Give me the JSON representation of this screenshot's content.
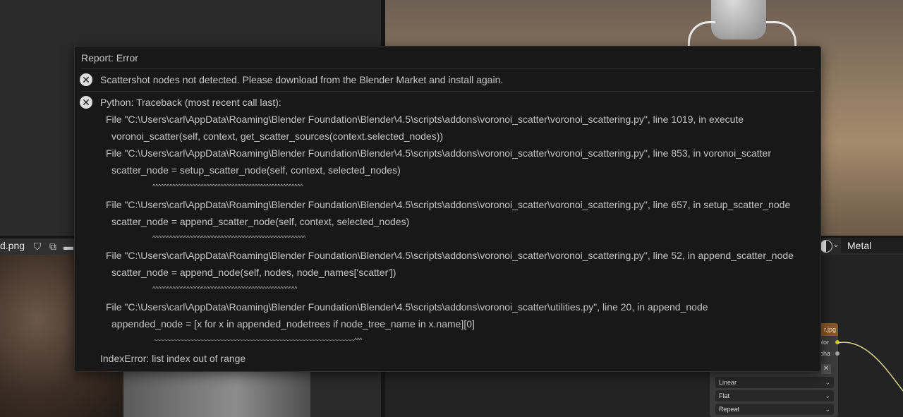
{
  "background": {
    "image_editor": {
      "image_name": "d.png",
      "header_icons": [
        "shield-icon",
        "duplicate-icon",
        "folder-icon"
      ]
    },
    "node_editor": {
      "material_name": "Metal",
      "node": {
        "title": "r.jpg",
        "outputs": [
          "olor",
          "lpha"
        ],
        "dropdowns": [
          "Linear",
          "Flat",
          "Repeat"
        ],
        "close_glyph": "✕"
      }
    },
    "colors": {
      "node_title": "#8a5624",
      "color_socket": "#c8c41e",
      "alpha_socket": "#a0a0a0",
      "wire": "#d8d48a"
    }
  },
  "report": {
    "title": "Report: Error",
    "icon": "error-x-icon",
    "messages": [
      "Scattershot nodes not detected. Please download from the Blender Market and install again.",
      "Python: Traceback (most recent call last):"
    ],
    "traceback": [
      "File \"C:\\Users\\carl\\AppData\\Roaming\\Blender Foundation\\Blender\\4.5\\scripts\\addons\\voronoi_scatter\\voronoi_scattering.py\", line 1019, in execute",
      "voronoi_scatter(self, context, get_scatter_sources(context.selected_nodes))",
      "File \"C:\\Users\\carl\\AppData\\Roaming\\Blender Foundation\\Blender\\4.5\\scripts\\addons\\voronoi_scatter\\voronoi_scattering.py\", line 853, in voronoi_scatter",
      "scatter_node = setup_scatter_node(self, context, selected_nodes)",
      "^^^^^^^^^^^^^^^^^^^^^^^^^^^^^^^^^^^^^^^^^^^^^^^^^^^^^",
      "File \"C:\\Users\\carl\\AppData\\Roaming\\Blender Foundation\\Blender\\4.5\\scripts\\addons\\voronoi_scatter\\voronoi_scattering.py\", line 657, in setup_scatter_node",
      "scatter_node = append_scatter_node(self, context, selected_nodes)",
      "^^^^^^^^^^^^^^^^^^^^^^^^^^^^^^^^^^^^^^^^^^^^^^^^^^^^^^",
      "File \"C:\\Users\\carl\\AppData\\Roaming\\Blender Foundation\\Blender\\4.5\\scripts\\addons\\voronoi_scatter\\voronoi_scattering.py\", line 52, in append_scatter_node",
      "scatter_node = append_node(self, nodes, node_names['scatter'])",
      "^^^^^^^^^^^^^^^^^^^^^^^^^^^^^^^^^^^^^^^^^^^^^^^^^^^",
      "File \"C:\\Users\\carl\\AppData\\Roaming\\Blender Foundation\\Blender\\4.5\\scripts\\addons\\voronoi_scatter\\utilities.py\", line 20, in append_node",
      "appended_node = [x for x in appended_nodetrees if node_tree_name in x.name][0]",
      "~~~~~~~~~~~~~~~~~~~~~~~~~~~~~~~~~~~~~~~~~~~~~~~~~~~~~~~~~~~~~^^^",
      "IndexError: list index out of range"
    ]
  }
}
